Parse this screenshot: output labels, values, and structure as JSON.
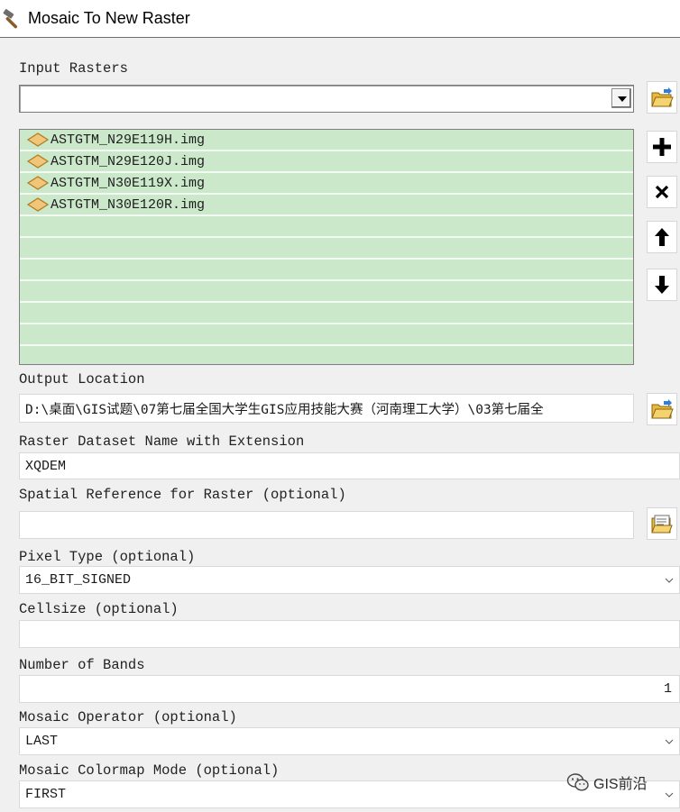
{
  "window": {
    "title": "Mosaic To New Raster",
    "app_icon": "hammer-icon"
  },
  "input_rasters": {
    "label": "Input Rasters",
    "value": "",
    "items": [
      {
        "name": "ASTGTM_N29E119H.img",
        "icon": "raster-dataset-icon"
      },
      {
        "name": "ASTGTM_N29E120J.img",
        "icon": "raster-dataset-icon"
      },
      {
        "name": "ASTGTM_N30E119X.img",
        "icon": "raster-dataset-icon"
      },
      {
        "name": "ASTGTM_N30E120R.img",
        "icon": "raster-dataset-icon"
      }
    ],
    "buttons": [
      "browse-folder-icon",
      "plus-icon",
      "close-icon",
      "arrow-up-icon",
      "arrow-down-icon"
    ]
  },
  "output_location": {
    "label": "Output Location",
    "value": "D:\\桌面\\GIS试题\\07第七届全国大学生GIS应用技能大赛（河南理工大学）\\03第七届全"
  },
  "raster_name": {
    "label": "Raster Dataset Name with Extension",
    "value": "XQDEM"
  },
  "spatial_reference": {
    "label": "Spatial Reference for Raster (optional)",
    "value": ""
  },
  "pixel_type": {
    "label": "Pixel Type (optional)",
    "value": "16_BIT_SIGNED"
  },
  "cellsize": {
    "label": "Cellsize (optional)",
    "value": ""
  },
  "bands": {
    "label": "Number of Bands",
    "value": "1"
  },
  "mosaic_operator": {
    "label": "Mosaic Operator (optional)",
    "value": "LAST"
  },
  "colormap_mode": {
    "label": "Mosaic Colormap Mode (optional)",
    "value": "FIRST"
  },
  "watermark": {
    "text": "GIS前沿",
    "icon": "wechat-icon"
  },
  "colors": {
    "list_background": "#cbe8cb",
    "list_row_divider": "#f3faf3",
    "panel_background": "#f0f0f0",
    "folder_yellow": "#e8b93a"
  }
}
